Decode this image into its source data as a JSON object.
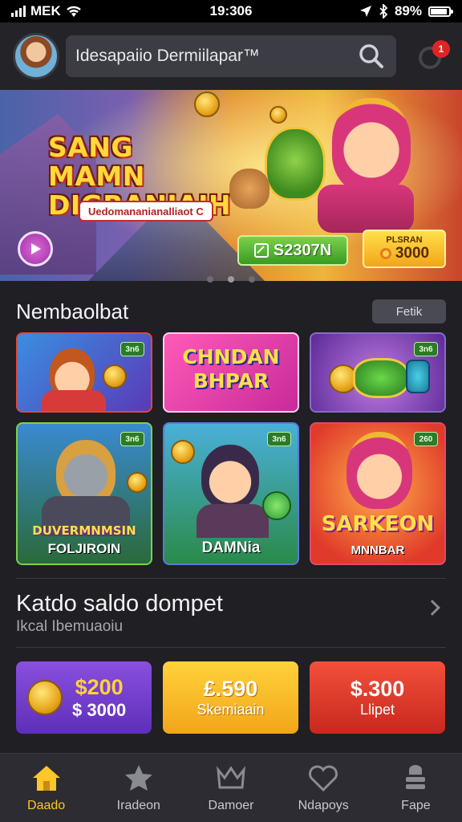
{
  "status_bar": {
    "carrier": "MEK",
    "time": "19:306",
    "battery": "89%"
  },
  "header": {
    "search_query": "Idesapaiio Dermiilapar™",
    "notification_count": "1"
  },
  "banner": {
    "title": "SANG MAMN DIGRANJAIH",
    "subtitle": "Uedomananianalliaot C",
    "cta_primary": "S2307N",
    "cta_secondary_label": "PLSRAN",
    "cta_secondary_value": "3000",
    "page_count": 3,
    "active_page": 1
  },
  "games_section": {
    "title": "Nembaolbat",
    "more_label": "Fetik",
    "tiles": [
      {
        "badge": "3n6",
        "title": "",
        "caption": ""
      },
      {
        "badge": "",
        "title": "CHNDAN BHPAR",
        "caption": ""
      },
      {
        "badge": "3n6",
        "title": "",
        "caption": ""
      },
      {
        "badge": "3n6",
        "title": "DUVERMNMSIN",
        "caption": "FOLJIROIN"
      },
      {
        "badge": "3n6",
        "title": "",
        "caption": "DAMNia"
      },
      {
        "badge": "260",
        "title": "SARKEON",
        "caption": "MNNBAR"
      }
    ]
  },
  "wallet": {
    "title": "Katdo saldo dompet",
    "subtitle": "Ikcal Ibemuaoiu",
    "cards": [
      {
        "amount": "$200",
        "sub": "$ 3000",
        "color": "#7a44d6"
      },
      {
        "amount": "£.590",
        "sub": "Skemiaain",
        "color": "#f6b928"
      },
      {
        "amount": "$.300",
        "sub": "Llipet",
        "color": "#e23a2a"
      }
    ]
  },
  "bottom_nav": {
    "items": [
      {
        "label": "Daado",
        "icon": "home-icon",
        "active": true
      },
      {
        "label": "Iradeon",
        "icon": "star-icon",
        "active": false
      },
      {
        "label": "Damoer",
        "icon": "crown-icon",
        "active": false
      },
      {
        "label": "Ndapoys",
        "icon": "heart-icon",
        "active": false
      },
      {
        "label": "Fape",
        "icon": "stack-icon",
        "active": false
      }
    ],
    "active_color": "#ffc629"
  }
}
